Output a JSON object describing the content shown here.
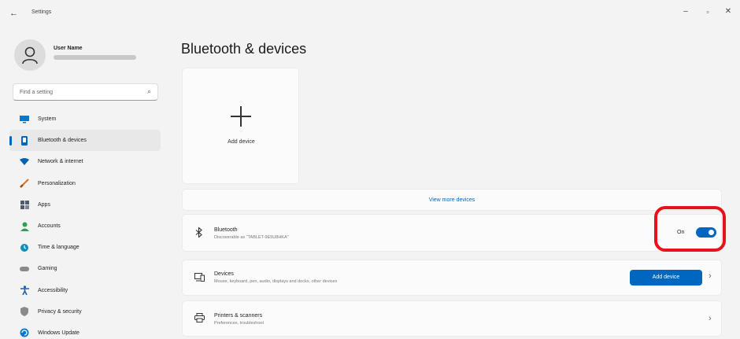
{
  "window": {
    "back_icon": "arrow-left-icon",
    "title": "Settings",
    "controls": {
      "minimize": "–",
      "maximize": "▫",
      "close": "✕"
    }
  },
  "profile": {
    "name": "User Name",
    "avatar_icon": "person-icon"
  },
  "search": {
    "placeholder": "Find a setting",
    "icon": "search-icon"
  },
  "nav": {
    "items": [
      {
        "label": "System",
        "icon": "monitor-icon",
        "color": "#0078d4"
      },
      {
        "label": "Bluetooth & devices",
        "icon": "bluetooth-devices-icon",
        "color": "#0067c0",
        "active": true
      },
      {
        "label": "Network & internet",
        "icon": "wifi-icon",
        "color": "#0063b1"
      },
      {
        "label": "Personalization",
        "icon": "brush-icon",
        "color": "#e07020"
      },
      {
        "label": "Apps",
        "icon": "apps-icon",
        "color": "#505a6e"
      },
      {
        "label": "Accounts",
        "icon": "person-icon",
        "color": "#2e9e58"
      },
      {
        "label": "Time & language",
        "icon": "globe-clock-icon",
        "color": "#0e8fb8"
      },
      {
        "label": "Gaming",
        "icon": "gamepad-icon",
        "color": "#808080"
      },
      {
        "label": "Accessibility",
        "icon": "accessibility-icon",
        "color": "#1a5fb4"
      },
      {
        "label": "Privacy & security",
        "icon": "shield-icon",
        "color": "#7d7d7d"
      },
      {
        "label": "Windows Update",
        "icon": "refresh-icon",
        "color": "#0078d4"
      }
    ]
  },
  "main": {
    "title": "Bluetooth & devices",
    "add_tile": {
      "label": "Add device",
      "icon": "plus-icon"
    },
    "view_more": "View more devices",
    "bluetooth": {
      "title": "Bluetooth",
      "subtitle": "Discoverable as \"TABLET-9E5U8HKA\"",
      "icon": "bluetooth-icon",
      "state_label": "On",
      "enabled": true
    },
    "devices": {
      "title": "Devices",
      "subtitle": "Mouse, keyboard, pen, audio, displays and docks, other devices",
      "icon": "devices-icon",
      "button": "Add device"
    },
    "printers": {
      "title": "Printers & scanners",
      "subtitle": "Preferences, troubleshoot",
      "icon": "printer-icon"
    }
  },
  "colors": {
    "accent": "#0067c0",
    "highlight": "#e8121c",
    "background": "#f3f3f3",
    "card": "#fbfbfb"
  }
}
